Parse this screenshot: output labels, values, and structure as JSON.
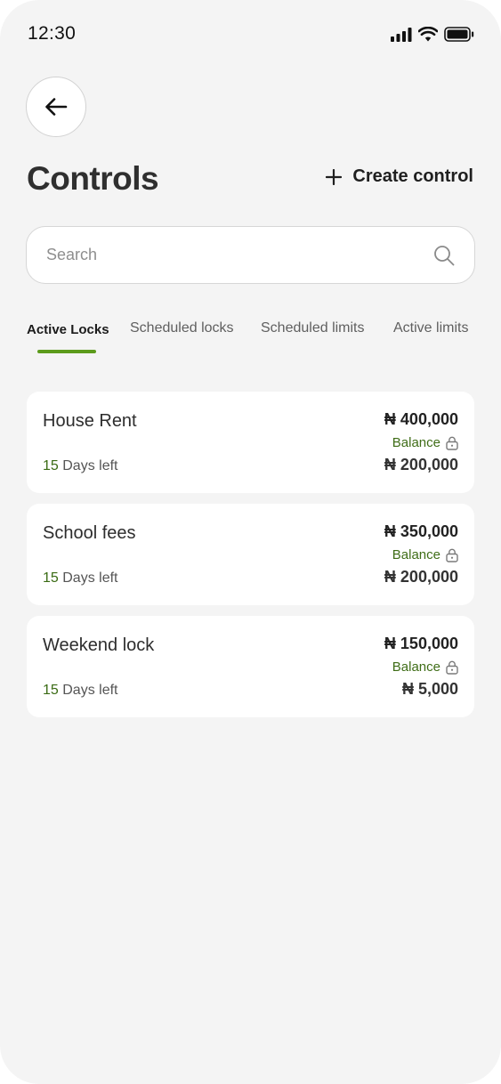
{
  "status_bar": {
    "time": "12:30"
  },
  "header": {
    "title": "Controls",
    "create_label": "Create control"
  },
  "search": {
    "placeholder": "Search"
  },
  "tabs": [
    {
      "label": "Active Locks",
      "active": true
    },
    {
      "label": "Scheduled locks",
      "active": false
    },
    {
      "label": "Scheduled limits",
      "active": false
    },
    {
      "label": "Active limits",
      "active": false
    }
  ],
  "locks": [
    {
      "name": "House Rent",
      "amount": "₦ 400,000",
      "balance_label": "Balance",
      "balance": "₦ 200,000",
      "days": "15",
      "days_suffix": "Days left"
    },
    {
      "name": "School fees",
      "amount": "₦ 350,000",
      "balance_label": "Balance",
      "balance": "₦ 200,000",
      "days": "15",
      "days_suffix": "Days left"
    },
    {
      "name": "Weekend lock",
      "amount": "₦ 150,000",
      "balance_label": "Balance",
      "balance": "₦ 5,000",
      "days": "15",
      "days_suffix": "Days left"
    }
  ],
  "colors": {
    "accent": "#5c9b1c",
    "accent_text": "#3f6d17",
    "background": "#f4f4f4"
  },
  "icons": [
    "signal-icon",
    "wifi-icon",
    "battery-icon",
    "back-arrow-icon",
    "plus-icon",
    "search-icon",
    "lock-icon"
  ]
}
